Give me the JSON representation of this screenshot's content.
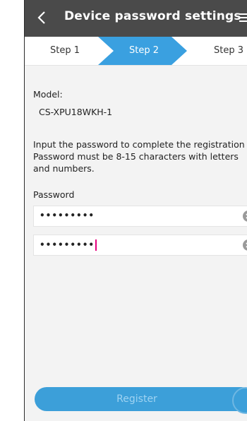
{
  "header": {
    "title": "Device password settings",
    "back_icon": "chevron-left-icon",
    "menu_icon": "hamburger-menu-icon"
  },
  "steps": {
    "items": [
      "Step 1",
      "Step 2",
      "Step 3"
    ],
    "active_index": 1,
    "active_color": "#3aa0e0"
  },
  "model": {
    "label": "Model:",
    "value": "CS-XPU18WKH-1"
  },
  "instructions": {
    "line1": "Input the password to complete the registration",
    "line2": "Password must be 8-15 characters with letters",
    "line3": "and numbers."
  },
  "password": {
    "label": "Password",
    "field1_value": "•••••••••",
    "field2_value": "•••••••••",
    "clear_icon": "clear-circle-icon"
  },
  "register": {
    "label": "Register",
    "color": "#3c9fd9"
  },
  "colors": {
    "header_bg": "#4a4a4a",
    "caret": "#e6007e"
  }
}
